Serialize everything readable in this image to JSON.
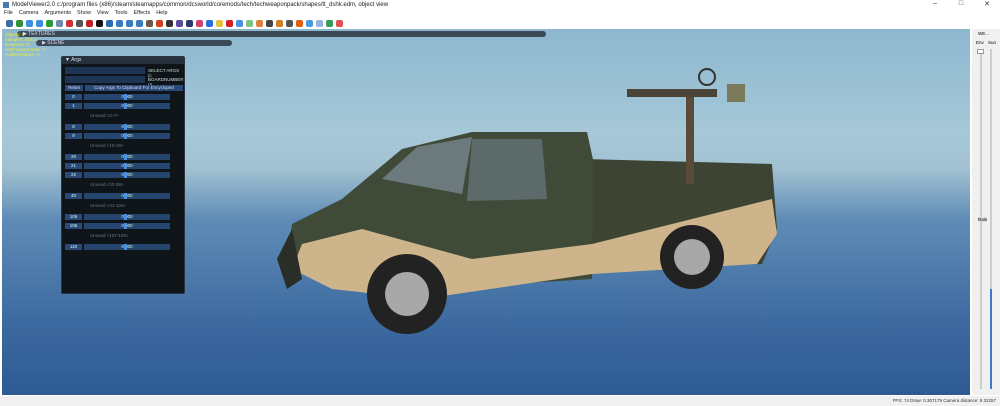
{
  "window": {
    "title": "ModelViewer2.0 c:/program files (x86)/steam/steamapps/common/dcsworld/coremods/tech/techweaponpack/shapes/tt_dshk.edm, object view"
  },
  "menu": [
    "File",
    "Camera",
    "Arguments",
    "Show",
    "View",
    "Tools",
    "Effects",
    "Help"
  ],
  "toolbar_colors": [
    "#3a6ea5",
    "#2f8f3a",
    "#3b8de0",
    "#3b8de0",
    "#2a9a3a",
    "#6a8ab0",
    "#d03030",
    "#555",
    "#c02020",
    "#111",
    "#2a6ab0",
    "#3a7ac0",
    "#3a7ac0",
    "#3a7ac0",
    "#6a5a4a",
    "#d04020",
    "#333",
    "#5a4aa0",
    "#2a3a6a",
    "#d04070",
    "#2a6ae0",
    "#e0c040",
    "#d02020",
    "#4a90e0",
    "#80c080",
    "#e08040",
    "#444",
    "#d08020",
    "#555",
    "#e06010",
    "#4a9ae0",
    "#9ab0e0",
    "#3a9a5a",
    "#e05050"
  ],
  "panels": {
    "textures": "TEXTURES",
    "scene": "SCENE"
  },
  "stats": [
    "objects: 6",
    "triangles: 93214",
    "instances: 0",
    "notShadowCaster: 0",
    "cullByDistance: 0"
  ],
  "args": {
    "title": "Args",
    "select_label": "SELECT ARGS (c",
    "board_label": "BOARDNUMBER (A",
    "reset": "Reset",
    "copy": "Copy Args To Clipboard For Encycloped",
    "rows": [
      {
        "idx": "0",
        "val": "0.000"
      },
      {
        "idx": "1",
        "val": "0.000"
      },
      {
        "unused": "Unused <2-7>"
      },
      {
        "idx": "8",
        "val": "0.000"
      },
      {
        "idx": "9",
        "val": "0.000"
      },
      {
        "unused": "Unused <10-19>"
      },
      {
        "idx": "20",
        "val": "0.000"
      },
      {
        "idx": "21",
        "val": "0.000"
      },
      {
        "idx": "22",
        "val": "0.000"
      },
      {
        "unused": "Unused <23-39>"
      },
      {
        "idx": "40",
        "val": "0.000"
      },
      {
        "unused": "Unused <41-104>"
      },
      {
        "idx": "105",
        "val": "0.000"
      },
      {
        "idx": "106",
        "val": "0.000"
      },
      {
        "unused": "Unused <107-109>"
      },
      {
        "idx": "110",
        "val": "0.000"
      }
    ]
  },
  "right_panel": {
    "title": "WE...",
    "env": "Env",
    "sun": "Sun",
    "rain": "Rain"
  },
  "status": "FPS: 74  Draw: 0.307179  Camera distance: 9.32257"
}
